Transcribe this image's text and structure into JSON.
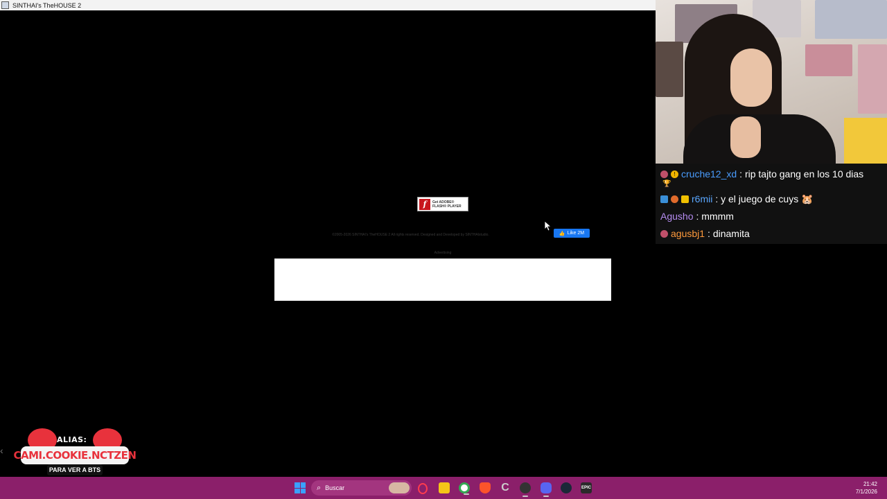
{
  "window": {
    "title": "SINTHAI's TheHOUSE 2"
  },
  "game": {
    "flash_badge": {
      "line1": "Get ADOBE®",
      "line2": "FLASH® PLAYER"
    },
    "copyright": "©2005-2026 SINTHAI's TheHOUSE 2 All rights reserved. Designed and Developed by SINTHAIstudio.",
    "fb_like_label": "Like 2M",
    "advertising_label": "Advertising"
  },
  "chat": {
    "messages": [
      {
        "user": "cruche12_xd",
        "text": ": rip tajto gang en los 10 dias",
        "user_color": "#4a9dff",
        "wrap": "🏆"
      },
      {
        "user": "r6mii",
        "text": ": y el juego de cuys 🐹",
        "user_color": "#5aa7ff"
      },
      {
        "user": "Agusho",
        "text": ": mmmm",
        "user_color": "#b58cf0"
      },
      {
        "user": "agusbj1",
        "text": ": dinamita",
        "user_color": "#ff9a3c"
      }
    ]
  },
  "overlay": {
    "alias_label": "ALIAS:",
    "name": "CAMI.COOKIE.NCTZEN",
    "sub": "PARA VER A BTS"
  },
  "taskbar": {
    "search_label": "Buscar",
    "time": "21:42",
    "date": "7/1/2026",
    "colors": {
      "background": "#8b1f6a",
      "accent": "#3aa0ff"
    }
  }
}
